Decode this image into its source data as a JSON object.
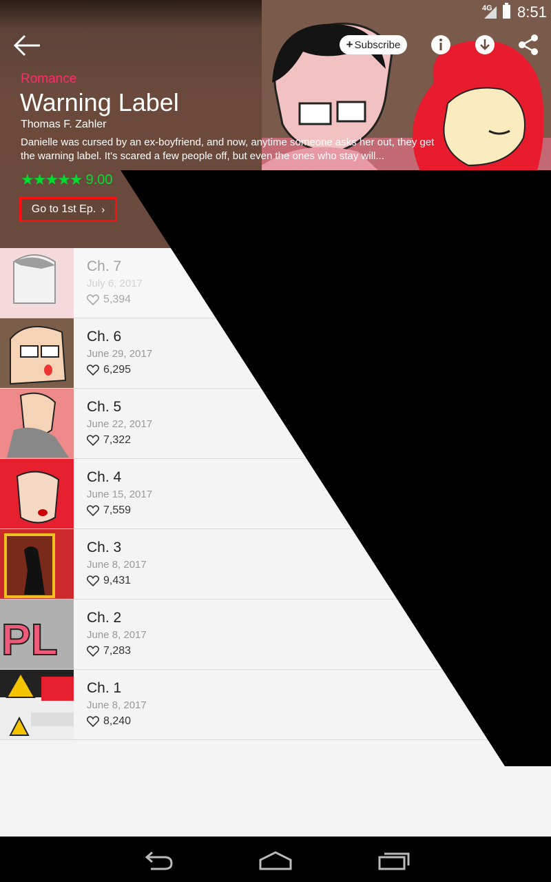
{
  "status_bar": {
    "network": "4G",
    "time": "8:51"
  },
  "header": {
    "subscribe_label": "Subscribe",
    "genre": "Romance",
    "title": "Warning Label",
    "author": "Thomas F. Zahler",
    "description": "Danielle was cursed by an ex-boyfriend, and now, anytime someone asks her out, they get the warning label. It's scared a few people off, but even the ones who stay will...",
    "rating": "9.00",
    "first_episode_label": "Go to 1st Ep.",
    "icons": [
      "back-arrow-icon",
      "info-icon",
      "download-icon",
      "share-icon"
    ],
    "colors": {
      "genre": "#ff2b6b",
      "rating": "#00dc30",
      "highlight_border": "#ff1010"
    }
  },
  "episodes": [
    {
      "title": "Ch. 7",
      "date": "July 6, 2017",
      "likes": "5,394"
    },
    {
      "title": "Ch. 6",
      "date": "June 29, 2017",
      "likes": "6,295"
    },
    {
      "title": "Ch. 5",
      "date": "June 22, 2017",
      "likes": "7,322"
    },
    {
      "title": "Ch. 4",
      "date": "June 15, 2017",
      "likes": "7,559"
    },
    {
      "title": "Ch. 3",
      "date": "June 8, 2017",
      "likes": "9,431"
    },
    {
      "title": "Ch. 2",
      "date": "June 8, 2017",
      "likes": "7,283"
    },
    {
      "title": "Ch. 1",
      "date": "June 8, 2017",
      "likes": "8,240"
    }
  ],
  "nav_bar": {
    "icons": [
      "back-nav-icon",
      "home-nav-icon",
      "recents-nav-icon"
    ]
  }
}
